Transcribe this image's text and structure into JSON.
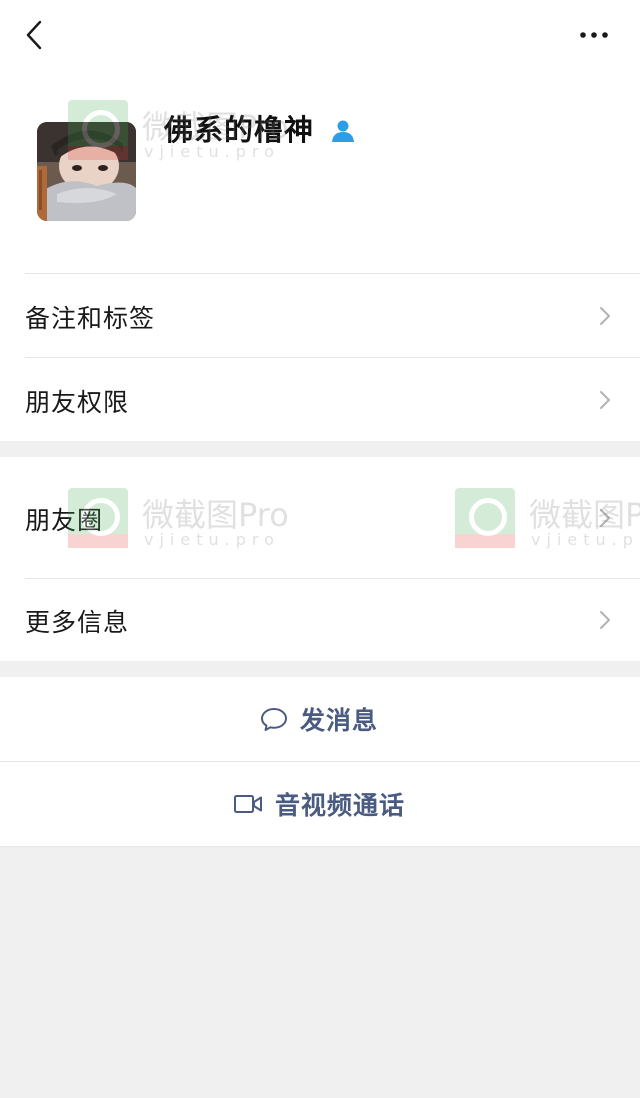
{
  "header": {
    "back_icon": "chevron-left-icon",
    "more_icon": "more-dots-icon"
  },
  "profile": {
    "name": "佛系的橹神",
    "badge_icon": "user-icon",
    "badge_color": "#2c9ee8"
  },
  "settings": {
    "items": [
      {
        "label": "备注和标签"
      },
      {
        "label": "朋友权限"
      },
      {
        "label": "朋友圈"
      },
      {
        "label": "更多信息"
      }
    ]
  },
  "actions": {
    "message": {
      "label": "发消息",
      "icon": "chat-bubble-icon"
    },
    "call": {
      "label": "音视频通话",
      "icon": "video-camera-icon"
    }
  },
  "colors": {
    "action_text": "#4a5b82",
    "background": "#f0f0f0",
    "card": "#ffffff"
  },
  "watermark": {
    "text": "微截图Pro",
    "sub": "vjietu.pro"
  }
}
